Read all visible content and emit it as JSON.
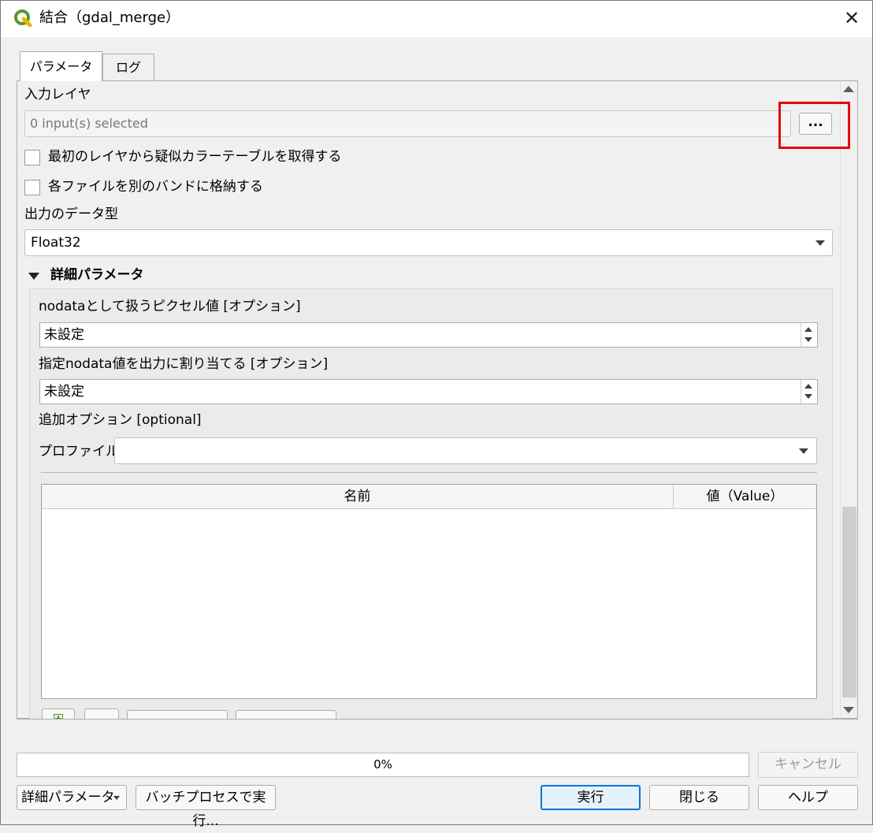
{
  "window": {
    "title": "結合（gdal_merge）",
    "close_symbol": "✕"
  },
  "tabs": [
    {
      "label": "パラメータ"
    },
    {
      "label": "ログ"
    }
  ],
  "params": {
    "input_layer_label": "入力レイヤ",
    "input_layer_value": "0 input(s) selected",
    "browse_button": "...",
    "pct_checkbox_label": "最初のレイヤから疑似カラーテーブルを取得する",
    "separate_checkbox_label": "各ファイルを別のバンドに格納する",
    "data_type_label": "出力のデータ型",
    "data_type_value": "Float32",
    "advanced_header": "詳細パラメータ",
    "nodata_input_label": "nodataとして扱うピクセル値 [オプション]",
    "nodata_input_value": "未設定",
    "nodata_output_label": "指定nodata値を出力に割り当てる [オプション]",
    "nodata_output_value": "未設定",
    "extra_options_label": "追加オプション [optional]",
    "profile_label": "プロファイル",
    "profile_value": "",
    "table_headers": [
      "名前",
      "値（Value）"
    ]
  },
  "bottom": {
    "progress_text": "0%",
    "progress_value": 0,
    "cancel_button": "キャンセル",
    "advanced_menu_button": "詳細パラメータ",
    "batch_button": "バッチプロセスで実行...",
    "run_button": "実行",
    "close_button": "閉じる",
    "help_button": "ヘルプ"
  },
  "colors": {
    "highlight": "#e60012",
    "qgis_green": "#589632",
    "qgis_yellow": "#f0b400",
    "focus_blue": "#0078d7"
  }
}
